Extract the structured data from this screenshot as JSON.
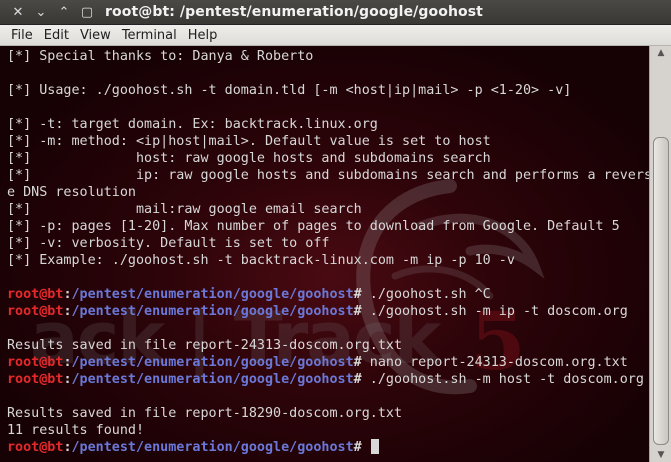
{
  "window": {
    "title": "root@bt: /pentest/enumeration/google/goohost"
  },
  "titlebar_buttons": [
    {
      "name": "close-button",
      "glyph": "✕"
    },
    {
      "name": "minimize-button",
      "glyph": "⌄"
    },
    {
      "name": "maximize-button",
      "glyph": "⌃"
    },
    {
      "name": "restore-button",
      "glyph": "▢"
    }
  ],
  "menu": [
    "File",
    "Edit",
    "View",
    "Terminal",
    "Help"
  ],
  "prompt": {
    "user": "root@bt",
    "sep": ":",
    "path": "/pentest/enumeration/google/goohost",
    "symbol": "# "
  },
  "terminal": {
    "lines": [
      {
        "type": "text",
        "text": "[*] Special thanks to: Danya & Roberto"
      },
      {
        "type": "text",
        "text": ""
      },
      {
        "type": "text",
        "text": "[*] Usage: ./goohost.sh -t domain.tld [-m <host|ip|mail> -p <1-20> -v]"
      },
      {
        "type": "text",
        "text": ""
      },
      {
        "type": "text",
        "text": "[*] -t: target domain. Ex: backtrack.linux.org"
      },
      {
        "type": "text",
        "text": "[*] -m: method: <ip|host|mail>. Default value is set to host"
      },
      {
        "type": "text",
        "text": "[*]             host: raw google hosts and subdomains search"
      },
      {
        "type": "text",
        "text": "[*]             ip: raw google hosts and subdomains search and performs a revers"
      },
      {
        "type": "text",
        "text": "e DNS resolution"
      },
      {
        "type": "text",
        "text": "[*]             mail:raw google email search"
      },
      {
        "type": "text",
        "text": "[*] -p: pages [1-20]. Max number of pages to download from Google. Default 5"
      },
      {
        "type": "text",
        "text": "[*] -v: verbosity. Default is set to off"
      },
      {
        "type": "text",
        "text": "[*] Example: ./goohost.sh -t backtrack-linux.com -m ip -p 10 -v"
      },
      {
        "type": "text",
        "text": ""
      },
      {
        "type": "prompt",
        "cmd": "./goohost.sh ^C"
      },
      {
        "type": "prompt",
        "cmd": "./goohost.sh -m ip -t doscom.org"
      },
      {
        "type": "text",
        "text": ""
      },
      {
        "type": "text",
        "text": "Results saved in file report-24313-doscom.org.txt"
      },
      {
        "type": "prompt",
        "cmd": "nano report-24313-doscom.org.txt"
      },
      {
        "type": "prompt",
        "cmd": "./goohost.sh -m host -t doscom.org"
      },
      {
        "type": "text",
        "text": ""
      },
      {
        "type": "text",
        "text": "Results saved in file report-18290-doscom.org.txt"
      },
      {
        "type": "text",
        "text": "11 results found!"
      },
      {
        "type": "prompt",
        "cmd": "",
        "cursor": true
      }
    ]
  },
  "wallpaper": {
    "text": "ack | Track",
    "number": "5"
  },
  "colors": {
    "prompt_user": "#e5292b",
    "prompt_path": "#6b78d8",
    "terminal_text": "#d8d8d8",
    "background": "#2c0409"
  },
  "scrollbar": {
    "position": 0.96
  }
}
